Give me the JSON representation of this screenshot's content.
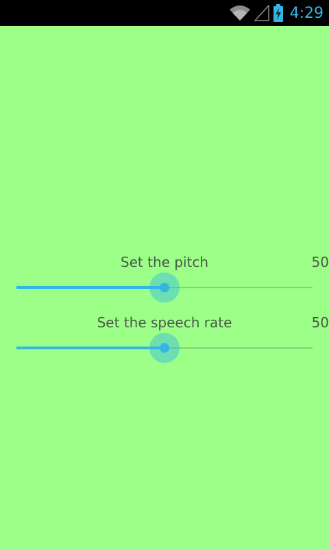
{
  "colors": {
    "background": "#9cff87",
    "accent": "#33b5e5",
    "status_bar": "#000000"
  },
  "status_bar": {
    "time": "4:29",
    "icons": [
      "wifi-icon",
      "signal-icon",
      "battery-charging-icon"
    ]
  },
  "pitch": {
    "label": "Set the pitch",
    "value": "50",
    "level": 0.5
  },
  "speech_rate": {
    "label": "Set the speech rate",
    "value": "50",
    "level": 0.5
  }
}
